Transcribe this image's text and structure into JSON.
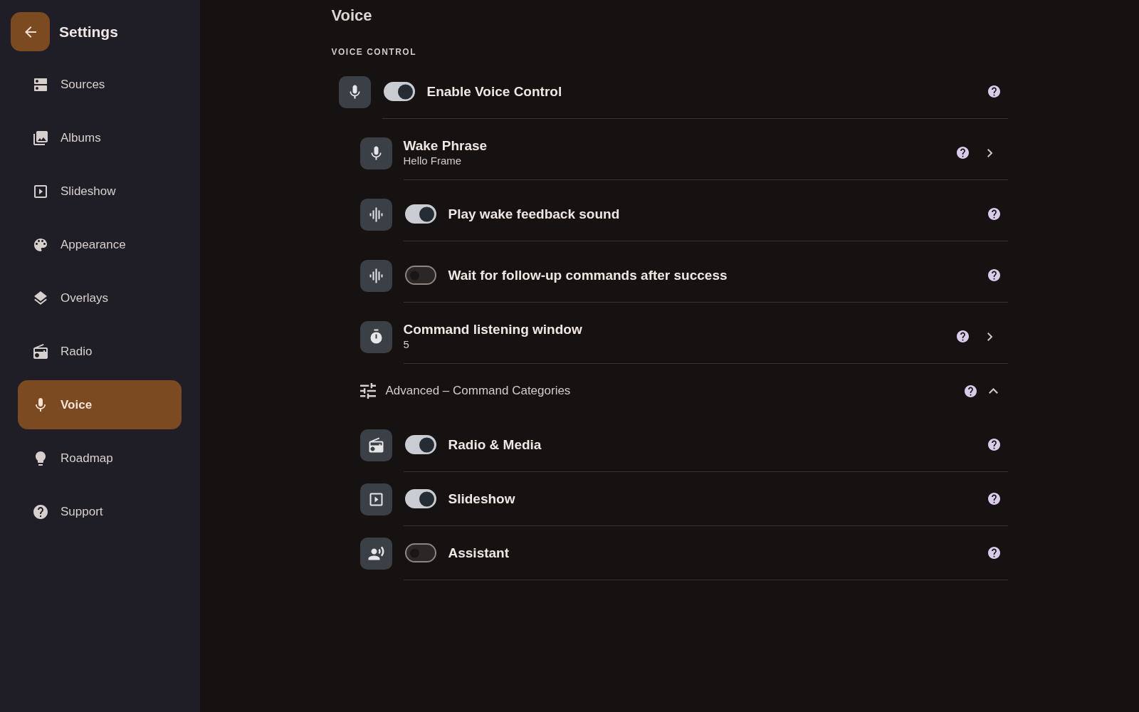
{
  "sidebar": {
    "title": "Settings",
    "items": [
      {
        "label": "Sources",
        "selected": false
      },
      {
        "label": "Albums",
        "selected": false
      },
      {
        "label": "Slideshow",
        "selected": false
      },
      {
        "label": "Appearance",
        "selected": false
      },
      {
        "label": "Overlays",
        "selected": false
      },
      {
        "label": "Radio",
        "selected": false
      },
      {
        "label": "Voice",
        "selected": true
      },
      {
        "label": "Roadmap",
        "selected": false
      },
      {
        "label": "Support",
        "selected": false
      }
    ]
  },
  "page": {
    "title": "Voice",
    "section": "VOICE CONTROL",
    "settings": [
      {
        "kind": "toggle",
        "label": "Enable Voice Control",
        "on": true,
        "children": [
          {
            "kind": "link",
            "label": "Wake Phrase",
            "value": "Hello Frame"
          },
          {
            "kind": "toggle",
            "label": "Play wake feedback sound",
            "on": true
          },
          {
            "kind": "toggle",
            "label": "Wait for follow-up commands after success",
            "on": false
          },
          {
            "kind": "link",
            "label": "Command listening window",
            "value": "5"
          },
          {
            "kind": "group",
            "label": "Advanced – Command Categories",
            "expanded": true,
            "children": [
              {
                "kind": "toggle",
                "label": "Radio & Media",
                "on": true
              },
              {
                "kind": "toggle",
                "label": "Slideshow",
                "on": true
              },
              {
                "kind": "toggle",
                "label": "Assistant",
                "on": false
              }
            ]
          }
        ]
      }
    ]
  }
}
